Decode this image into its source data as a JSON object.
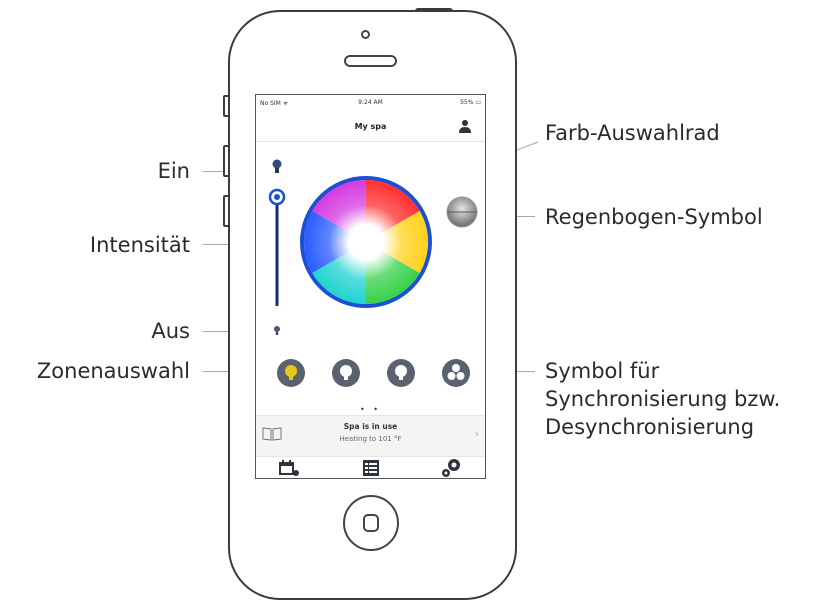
{
  "annotations": {
    "ein": "Ein",
    "intensitaet": "Intensität",
    "aus": "Aus",
    "zonenauswahl": "Zonenauswahl",
    "farb_auswahlrad": "Farb-Auswahlrad",
    "regenbogen_symbol": "Regenbogen-Symbol",
    "sync_line1": "Symbol für",
    "sync_line2": "Synchronisierung bzw.",
    "sync_line3": "Desynchronisierung"
  },
  "status_bar": {
    "carrier": "No SIM ᯤ",
    "time": "9:24 AM",
    "battery": "55% ▭"
  },
  "app": {
    "title": "My spa",
    "page_indicator": "• •",
    "status_title": "Spa is in use",
    "status_subtitle": "Heating to 101 °F"
  },
  "intensity": {
    "level": 1.0
  },
  "colors": {
    "accent_blue": "#1a4fd6",
    "zone_active": "#e8c81a",
    "zone_inactive": "#5a6270"
  },
  "icons": {
    "user": "user-icon",
    "bulb_on": "bulb-on-icon",
    "bulb_off": "bulb-off-icon",
    "rainbow": "rainbow-icon",
    "sync": "sync-icon",
    "book": "book-icon",
    "schedule": "calendar-icon",
    "list": "list-icon",
    "settings": "settings-icon"
  }
}
